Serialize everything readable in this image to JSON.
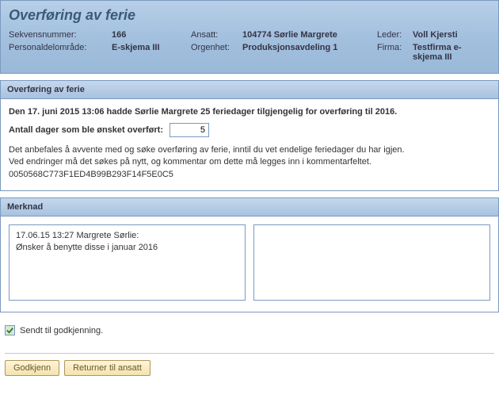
{
  "header": {
    "title": "Overføring av ferie",
    "meta": {
      "sekvens_label": "Sekvensnummer:",
      "sekvens_value": "166",
      "ansatt_label": "Ansatt:",
      "ansatt_value": "104774 Sørlie Margrete",
      "leder_label": "Leder:",
      "leder_value": "Voll Kjersti",
      "persomr_label": "Personaldelområde:",
      "persomr_value": "E-skjema III",
      "orgenhet_label": "Orgenhet:",
      "orgenhet_value": "Produksjonsavdeling 1",
      "firma_label": "Firma:",
      "firma_value": "Testfirma e-skjema III"
    }
  },
  "panel1": {
    "title": "Overføring av ferie",
    "intro": "Den 17. juni 2015 13:06 hadde Sørlie Margrete 25 feriedager tilgjengelig for overføring til 2016.",
    "days_label": "Antall dager som ble ønsket overført:",
    "days_value": "5",
    "info1": "Det anbefales å avvente med og søke overføring av ferie, inntil du vet endelige feriedager du har igjen.",
    "info2": "Ved endringer må det søkes på nytt, og kommentar om dette må legges inn i kommentarfeltet.",
    "hash": "0050568C773F1ED4B99B293F14F5E0C5"
  },
  "panel2": {
    "title": "Merknad",
    "note_line1": "17.06.15 13:27 Margrete Sørlie:",
    "note_line2": "Ønsker å benytte disse i januar 2016"
  },
  "status": {
    "text": "Sendt til godkjenning."
  },
  "buttons": {
    "godkjenn": "Godkjenn",
    "returner": "Returner til ansatt"
  }
}
